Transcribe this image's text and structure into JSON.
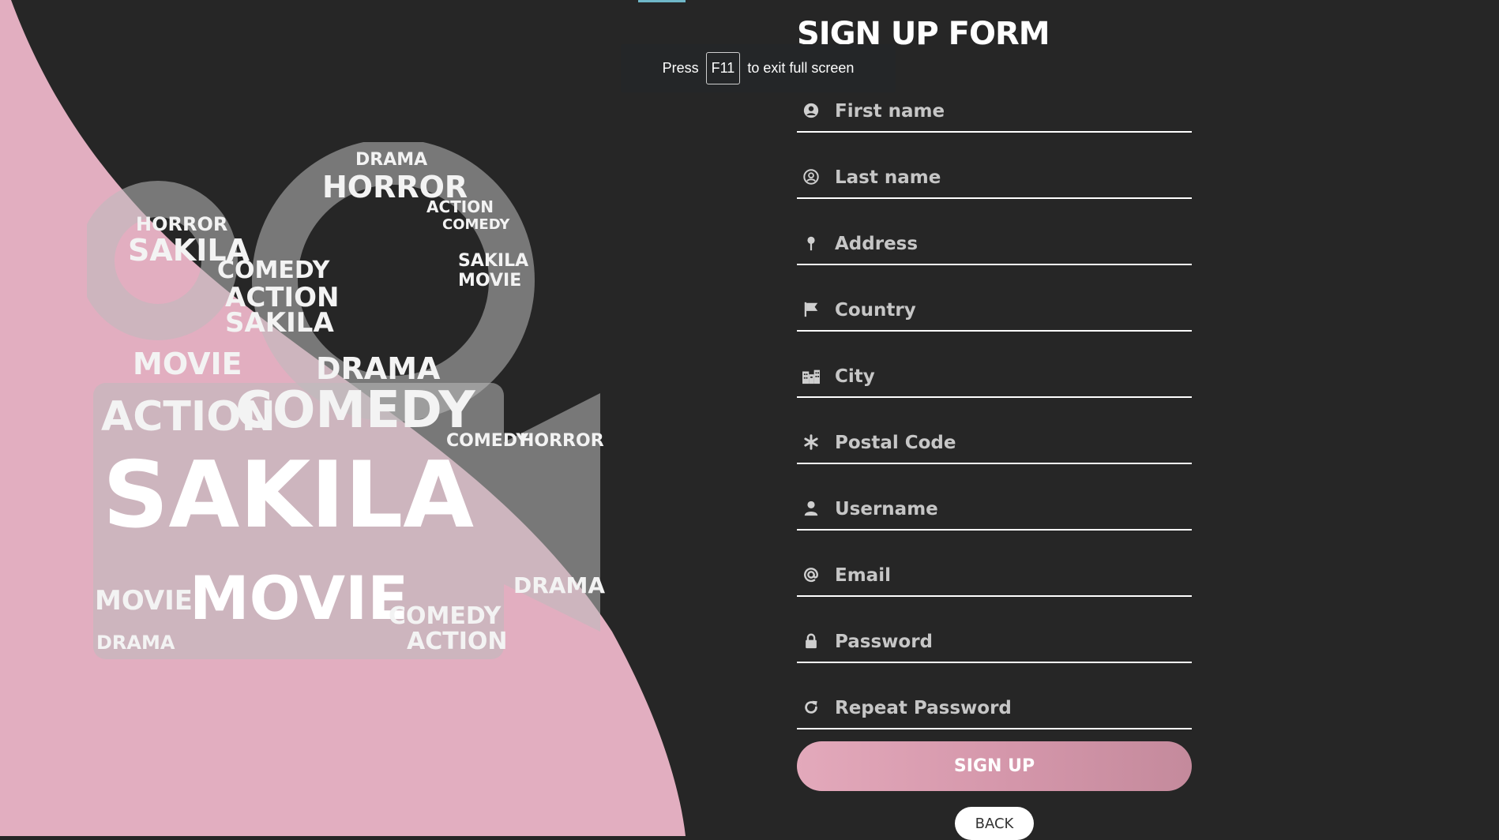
{
  "form": {
    "title": "SIGN UP FORM",
    "fields": [
      {
        "placeholder": "First name",
        "icon": "user-circle-icon"
      },
      {
        "placeholder": "Last name",
        "icon": "user-circle-outline-icon"
      },
      {
        "placeholder": "Address",
        "icon": "map-pin-icon"
      },
      {
        "placeholder": "Country",
        "icon": "flag-icon"
      },
      {
        "placeholder": "City",
        "icon": "city-icon"
      },
      {
        "placeholder": "Postal Code",
        "icon": "asterisk-icon"
      },
      {
        "placeholder": "Username",
        "icon": "user-icon"
      },
      {
        "placeholder": "Email",
        "icon": "at-icon"
      },
      {
        "placeholder": "Password",
        "icon": "lock-icon"
      },
      {
        "placeholder": "Repeat Password",
        "icon": "refresh-icon"
      }
    ],
    "signup_label": "SIGN UP",
    "back_label": "BACK"
  },
  "fullscreen_notice": {
    "before": "Press",
    "key": "F11",
    "after": "to exit full screen"
  },
  "illustration": {
    "words": [
      "SAKILA",
      "MOVIE",
      "COMEDY",
      "ACTION",
      "HORROR",
      "DRAMA"
    ]
  },
  "colors": {
    "background": "#262626",
    "accent_pink": "#e2aec0",
    "text": "#ffffff",
    "placeholder": "#c6c6c6"
  }
}
